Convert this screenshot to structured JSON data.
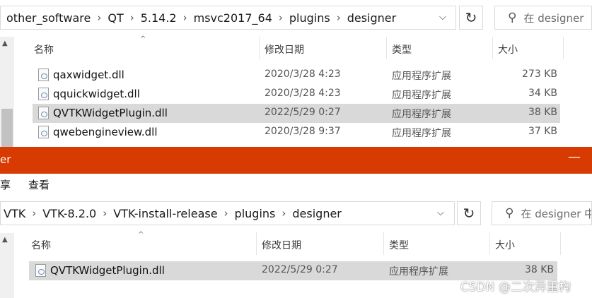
{
  "top_window": {
    "breadcrumb": [
      "other_software",
      "QT",
      "5.14.2",
      "msvc2017_64",
      "plugins",
      "designer"
    ],
    "search_placeholder": "在 designer",
    "columns": {
      "name": "名称",
      "modified": "修改日期",
      "type": "类型",
      "size": "大小"
    },
    "files": [
      {
        "name": "qaxwidget.dll",
        "modified": "2020/3/28 4:23",
        "type": "应用程序扩展",
        "size": "273 KB",
        "selected": false
      },
      {
        "name": "qquickwidget.dll",
        "modified": "2020/3/28 4:23",
        "type": "应用程序扩展",
        "size": "34 KB",
        "selected": false
      },
      {
        "name": "QVTKWidgetPlugin.dll",
        "modified": "2022/5/29 0:27",
        "type": "应用程序扩展",
        "size": "38 KB",
        "selected": true
      },
      {
        "name": "qwebengineview.dll",
        "modified": "2020/3/28 9:37",
        "type": "应用程序扩展",
        "size": "37 KB",
        "selected": false
      }
    ]
  },
  "bottom_window": {
    "title": "er",
    "menu": [
      "享",
      "查看"
    ],
    "breadcrumb": [
      "VTK",
      "VTK-8.2.0",
      "VTK-install-release",
      "plugins",
      "designer"
    ],
    "search_placeholder": "在 designer 中",
    "columns": {
      "name": "名称",
      "modified": "修改日期",
      "type": "类型",
      "size": "大小"
    },
    "files": [
      {
        "name": "QVTKWidgetPlugin.dll",
        "modified": "2022/5/29 0:27",
        "type": "应用程序扩展",
        "size": "38 KB",
        "selected": true
      }
    ]
  },
  "watermark": "CSDN @二次异重构",
  "colors": {
    "titlebar": "#d83b01",
    "selection": "#d9d9d9"
  }
}
